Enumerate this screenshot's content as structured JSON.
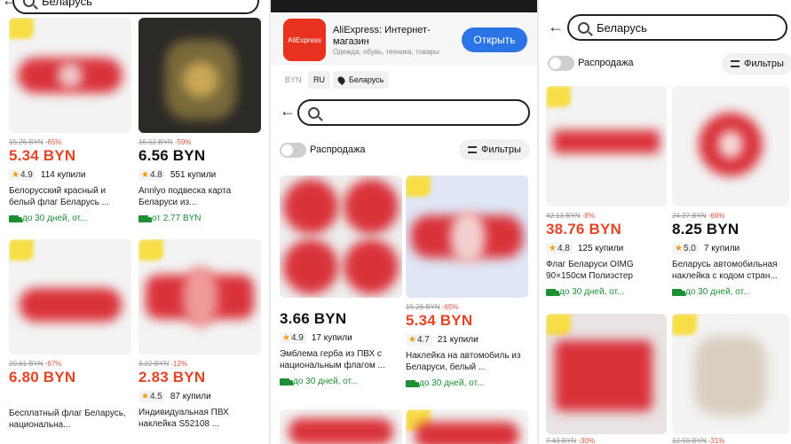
{
  "colors": {
    "price_red": "#e54525",
    "discount": "#e0533a",
    "shipping_green": "#1d8f33",
    "star": "#f19a15",
    "open_button": "#2a74e6",
    "aliexpress_red": "#e8321e",
    "flag_red": "#d9333a"
  },
  "panel1": {
    "search_value": "Беларусь",
    "products": [
      {
        "old_price": "15.26 BYN",
        "discount": "-65%",
        "price": "5.34 BYN",
        "price_red": true,
        "rating": "4.9",
        "sold": "114 купили",
        "title": "Белорусский красный и белый флаг Беларусь ...",
        "shipping": "до 30 дней, от..."
      },
      {
        "old_price": "16.02 BYN",
        "discount": "-59%",
        "price": "6.56 BYN",
        "price_red": false,
        "rating": "4.8",
        "sold": "551 купили",
        "title": "Annlyo подвеска карта Беларуси из...",
        "shipping": "от 2.77 BYN"
      },
      {
        "old_price": "20.61 BYN",
        "discount": "-67%",
        "price": "6.80 BYN",
        "price_red": true,
        "rating": "",
        "sold": "",
        "title": "Бесплатный флаг Беларусь, национальна...",
        "shipping": ""
      },
      {
        "old_price": "3.22 BYN",
        "discount": "-12%",
        "price": "2.83 BYN",
        "price_red": true,
        "rating": "4.5",
        "sold": "87 купили",
        "title": "Индивидуальная ПВХ наклейка S52108 ...",
        "shipping": ""
      }
    ]
  },
  "panel2": {
    "ad": {
      "logo_text": "AliExpress",
      "title_line1": "AliExpress: Интернет-",
      "title_line2": "магазин",
      "subtitle": "Одежда, обувь, техника, товары",
      "open_label": "Открыть"
    },
    "chips": {
      "currency": "BYN",
      "language": "RU",
      "country": "Беларусь"
    },
    "search_value": "",
    "sale_label": "Распродажа",
    "filters_label": "Фильтры",
    "products": [
      {
        "old_price": "",
        "discount": "",
        "price": "3.66 BYN",
        "price_red": false,
        "rating": "4.9",
        "sold": "17 купили",
        "title": "Эмблема герба из ПВХ с национальным флагом ...",
        "shipping": "до 30 дней, от..."
      },
      {
        "old_price": "15.26 BYN",
        "discount": "-65%",
        "price": "5.34 BYN",
        "price_red": true,
        "rating": "4.7",
        "sold": "21 купили",
        "title": "Наклейка на автомобиль из Беларуси, белый ...",
        "shipping": "до 30 дней, от..."
      }
    ]
  },
  "panel3": {
    "search_value": "Беларусь",
    "sale_label": "Распродажа",
    "filters_label": "Фильтры",
    "products": [
      {
        "old_price": "42.13 BYN",
        "discount": "-8%",
        "price": "38.76 BYN",
        "price_red": true,
        "rating": "4.8",
        "sold": "125 купили",
        "title": "Флаг Беларуси OIMG 90×150см Полиэстер",
        "shipping": "до 30 дней, от..."
      },
      {
        "old_price": "24.27 BYN",
        "discount": "-66%",
        "price": "8.25 BYN",
        "price_red": false,
        "rating": "5.0",
        "sold": "7 купили",
        "title": "Беларусь автомобильная наклейка с кодом стран...",
        "shipping": "до 30 дней, от..."
      },
      {
        "old_price": "7.43 BYN",
        "discount": "-30%",
        "price": "",
        "price_red": false,
        "rating": "",
        "sold": "",
        "title": "",
        "shipping": ""
      },
      {
        "old_price": "12.50 BYN",
        "discount": "-31%",
        "price": "",
        "price_red": false,
        "rating": "",
        "sold": "",
        "title": "",
        "shipping": ""
      }
    ]
  }
}
